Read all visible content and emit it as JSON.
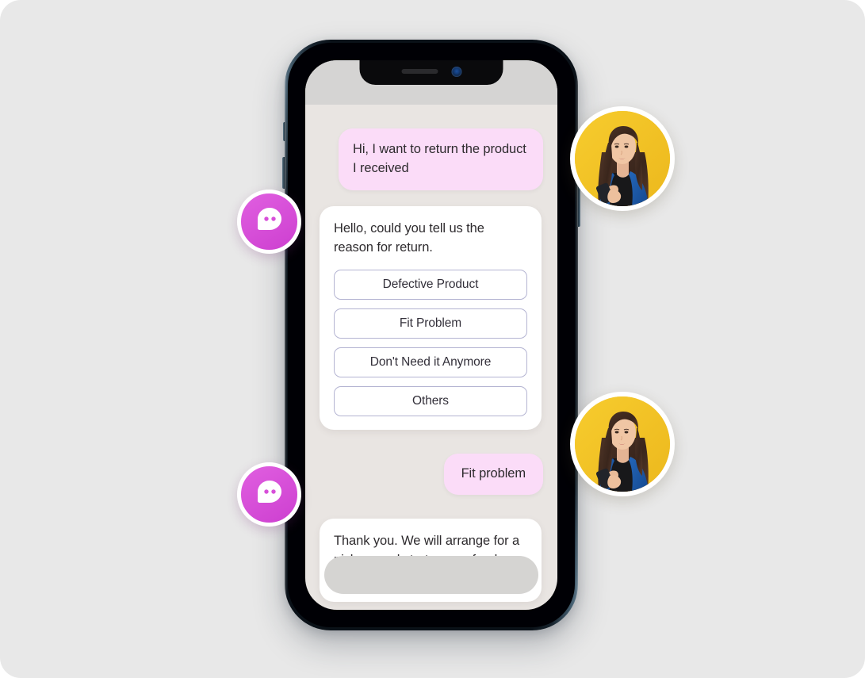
{
  "canvas": {
    "background_color": "#e8e8e8"
  },
  "device": {
    "name": "smartphone-mockup",
    "frame_color": "#0a1118",
    "bezel_highlight_color": "#7b95a6",
    "screen_background_color": "#e9e5e2",
    "status_bar_color": "#d5d4d3"
  },
  "chat": {
    "messages": [
      {
        "id": "msg-1",
        "sender": "user",
        "text": "Hi, I want to return the product I received",
        "bubble_color": "#fbdcf8"
      },
      {
        "id": "msg-2",
        "sender": "bot",
        "text": "Hello, could you tell us the reason for return.",
        "bubble_color": "#ffffff",
        "options": [
          "Defective Product",
          "Fit Problem",
          "Don't Need it Anymore",
          "Others"
        ],
        "option_border_color": "#b4b4d2"
      },
      {
        "id": "msg-3",
        "sender": "user",
        "text": "Fit problem",
        "bubble_color": "#fbdcf8"
      },
      {
        "id": "msg-4",
        "sender": "bot",
        "text": "Thank you. We will arrange for a pick up and start your refund process.",
        "bubble_color": "#ffffff"
      }
    ],
    "input_placeholder": ""
  },
  "badges": [
    {
      "id": "bot-badge-top",
      "icon": "chat-bubble-icon",
      "color": "#d74fd9"
    },
    {
      "id": "bot-badge-bottom",
      "icon": "chat-bubble-icon",
      "color": "#d74fd9"
    }
  ],
  "avatars": [
    {
      "id": "avatar-top",
      "alt": "woman-using-phone",
      "background_color": "#f2c42a"
    },
    {
      "id": "avatar-bottom",
      "alt": "woman-using-phone",
      "background_color": "#f2c42a"
    }
  ]
}
